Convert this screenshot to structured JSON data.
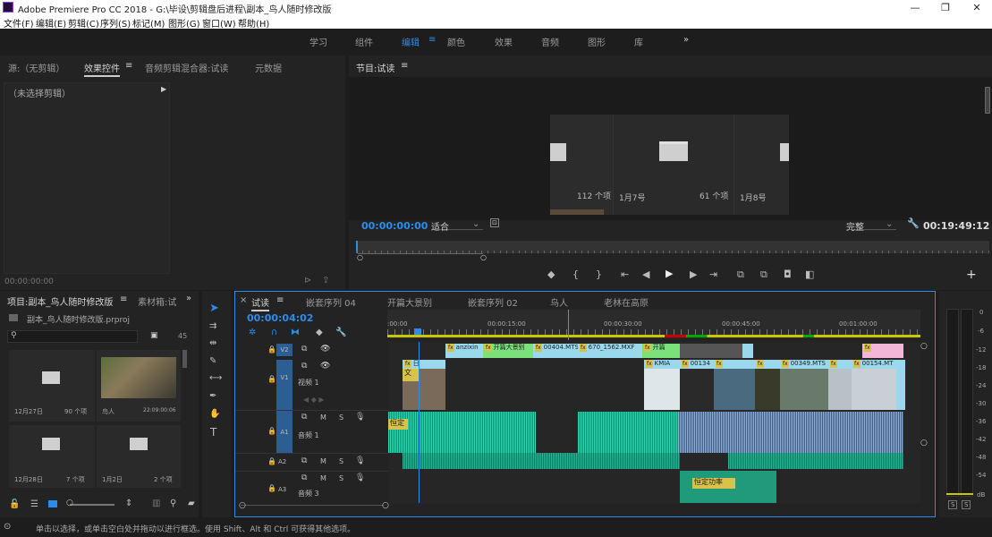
{
  "title": "Adobe Premiere Pro CC 2018 - G:\\毕设\\剪辑盘后进程\\副本_鸟人随时修改版",
  "window_controls": [
    "—",
    "❐",
    "✕"
  ],
  "menu": [
    "文件(F)",
    "编辑(E)",
    "剪辑(C)",
    "序列(S)",
    "标记(M)",
    "图形(G)",
    "窗口(W)",
    "帮助(H)"
  ],
  "workspaces": [
    "学习",
    "组件",
    "编辑",
    "颜色",
    "效果",
    "音频",
    "图形",
    "库"
  ],
  "source_panel": {
    "tabs": [
      "源:（无剪辑）",
      "效果控件",
      "音频剪辑混合器:试读",
      "元数据"
    ],
    "no_clip": "（未选择剪辑）",
    "timecode": "00:00:00:00"
  },
  "program": {
    "tab": "节目:试读",
    "timecode_left": "00:00:00:00",
    "fit": "适合",
    "quality": "完整",
    "duration": "00:19:49:12",
    "overlay": [
      {
        "count": "112 个项"
      },
      {
        "label": "1月7号",
        "count": "61 个项"
      },
      {
        "label": "1月8号"
      }
    ]
  },
  "project": {
    "tabs": [
      "项目:副本_鸟人随时修改版",
      "素材箱:试"
    ],
    "file": "副本_鸟人随时修改版.prproj",
    "count": "45",
    "bins": [
      {
        "name": "12月27日",
        "count": "90 个项"
      },
      {
        "name": "鸟人",
        "count": "22:09:00:06"
      },
      {
        "name": "12月28日",
        "count": "7 个项"
      },
      {
        "name": "1月2日",
        "count": "2 个项"
      }
    ]
  },
  "timeline": {
    "tabs": [
      "试读",
      "嵌套序列 04",
      "开篇大景别",
      "嵌套序列 02",
      "鸟人",
      "老林在高原"
    ],
    "timecode": "00:00:04:02",
    "ruler": [
      ":00:00",
      "00:00:15:00",
      "00:00:30:00",
      "00:00:45:00",
      "00:01:00:00"
    ],
    "tracks": {
      "v2": "V2",
      "v1": "V1",
      "video1": "视频 1",
      "a1": "A1",
      "audio1": "音频 1",
      "a2": "A2",
      "a3": "A3",
      "audio3": "音频 3"
    },
    "clip_labels": {
      "anzixin": "anzixin",
      "kaipian": "开篇大景别",
      "c00404": "00404.MTS",
      "c670": "670_1562.MXF",
      "kaipian2": "开篇",
      "kmia": "KMIA",
      "c0134": "00134",
      "c00349": "00349.MTS",
      "c00154": "00154.MT",
      "wen": "文",
      "ri": "日",
      "hengding": "恒定",
      "hengding_gonglv": "恒定功率"
    },
    "msb": [
      "M",
      "S"
    ]
  },
  "meter": {
    "labels": [
      "0",
      "-6",
      "-12",
      "-18",
      "-24",
      "-30",
      "-36",
      "-42",
      "-48",
      "-54",
      "dB"
    ],
    "solo": [
      "S",
      "S"
    ]
  },
  "status": "单击以选择，或单击空白处并拖动以进行框选。使用 Shift、Alt 和 Ctrl 可获得其他选项。",
  "colors": {
    "accent": "#2d8ceb",
    "video_clip": "#9ad8ee",
    "green_clip": "#7be27b",
    "audio_clip": "#1f9a7a",
    "audio_clip2": "#6a8bc0",
    "pink_clip": "#f4b6d8"
  }
}
